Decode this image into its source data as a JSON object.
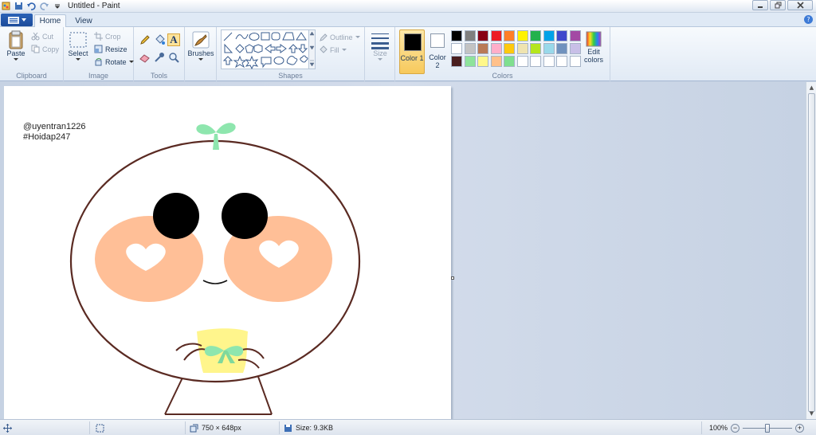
{
  "window": {
    "title": "Untitled - Paint"
  },
  "tabs": [
    {
      "label": "Home"
    },
    {
      "label": "View"
    }
  ],
  "clipboard": {
    "paste": "Paste",
    "cut": "Cut",
    "copy": "Copy",
    "label": "Clipboard"
  },
  "image": {
    "select": "Select",
    "crop": "Crop",
    "resize": "Resize",
    "rotate": "Rotate",
    "label": "Image"
  },
  "tools": {
    "label": "Tools",
    "text_tool_glyph": "A"
  },
  "brushes": {
    "label": "Brushes"
  },
  "shapes": {
    "outline": "Outline",
    "fill": "Fill",
    "label": "Shapes"
  },
  "size": {
    "label": "Size"
  },
  "colors": {
    "color1": "Color 1",
    "color2": "Color 2",
    "edit": "Edit colors",
    "label": "Colors",
    "primary": "#000000",
    "secondary": "#ffffff",
    "row1": [
      "#000000",
      "#7f7f7f",
      "#880015",
      "#ed1c24",
      "#ff7f27",
      "#fff200",
      "#22b14c",
      "#00a2e8",
      "#3f48cc",
      "#a349a4"
    ],
    "row2": [
      "#ffffff",
      "#c3c3c3",
      "#b97a57",
      "#ffaec9",
      "#ffc90e",
      "#efe4b0",
      "#b5e61d",
      "#99d9ea",
      "#7092be",
      "#c8bfe7"
    ],
    "row3": [
      "#4a1f1f",
      "#8ee39b",
      "#fff88a",
      "#ffc08a",
      "#7fdf8f",
      "#ffffff",
      "#ffffff",
      "#ffffff",
      "#ffffff",
      "#ffffff"
    ]
  },
  "drawing": {
    "watermark_user": "@uyentran1226",
    "watermark_tag": "#Hoidap247",
    "outline_color": "#5a2a22",
    "blush_color": "#ffbf97",
    "sprout_color": "#8ee6ae",
    "shirt_color": "#fff58c"
  },
  "status": {
    "dimensions": "750 × 648px",
    "size": "Size: 9.3KB",
    "zoom": "100%"
  }
}
